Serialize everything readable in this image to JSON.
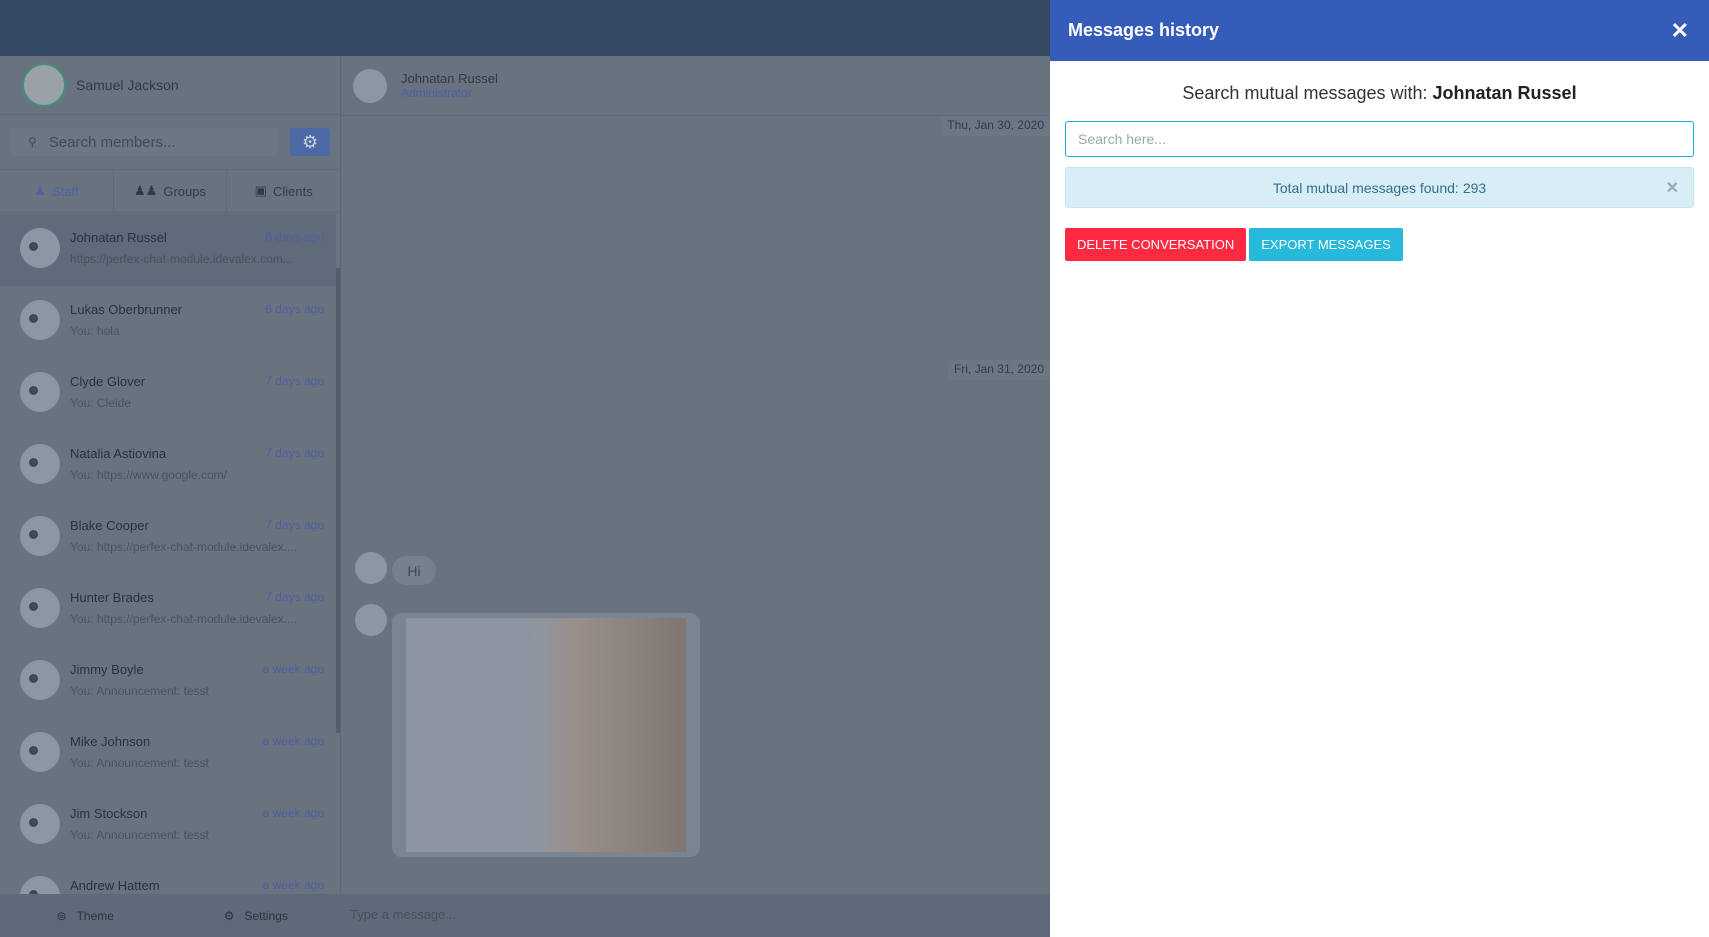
{
  "user": {
    "name": "Samuel Jackson"
  },
  "sidebar": {
    "search_placeholder": "Search members...",
    "tabs": [
      {
        "label": "Staff",
        "icon": "user-icon"
      },
      {
        "label": "Groups",
        "icon": "users-icon"
      },
      {
        "label": "Clients",
        "icon": "address-book-icon"
      }
    ],
    "contacts": [
      {
        "name": "Johnatan Russel",
        "time": "6 days ago",
        "preview": "https://perfex-chat-module.idevalex.com..."
      },
      {
        "name": "Lukas Oberbrunner",
        "time": "6 days ago",
        "preview": "You: hola"
      },
      {
        "name": "Clyde Glover",
        "time": "7 days ago",
        "preview": "You: Cleide"
      },
      {
        "name": "Natalia Astiovina",
        "time": "7 days ago",
        "preview": "You: https://www.google.com/"
      },
      {
        "name": "Blake Cooper",
        "time": "7 days ago",
        "preview": "You: https://perfex-chat-module.idevalex...."
      },
      {
        "name": "Hunter Brades",
        "time": "7 days ago",
        "preview": "You: https://perfex-chat-module.idevalex...."
      },
      {
        "name": "Jimmy Boyle",
        "time": "a week ago",
        "preview": "You: Announcement: tesst"
      },
      {
        "name": "Mike Johnson",
        "time": "a week ago",
        "preview": "You: Announcement: tesst"
      },
      {
        "name": "Jim Stockson",
        "time": "a week ago",
        "preview": "You: Announcement: tesst"
      },
      {
        "name": "Andrew Hattem",
        "time": "a week ago",
        "preview": ""
      }
    ],
    "footer": {
      "theme": "Theme",
      "settings": "Settings"
    }
  },
  "chat": {
    "contact_name": "Johnatan Russel",
    "contact_role": "Administrator",
    "dates": [
      "Thu, Jan 30, 2020",
      "Fri, Jan 31, 2020"
    ],
    "message": "Hi",
    "composer_placeholder": "Type a message..."
  },
  "panel": {
    "title": "Messages history",
    "subtitle_prefix": "Search mutual messages with: ",
    "subtitle_name": "Johnatan Russel",
    "search_placeholder": "Search here...",
    "alert_prefix": "Total mutual messages found: ",
    "alert_count": "293",
    "delete_label": "DELETE CONVERSATION",
    "export_label": "EXPORT MESSAGES",
    "colors": {
      "header": "#365cba",
      "delete": "#fd2a42",
      "export": "#27b9db"
    }
  }
}
